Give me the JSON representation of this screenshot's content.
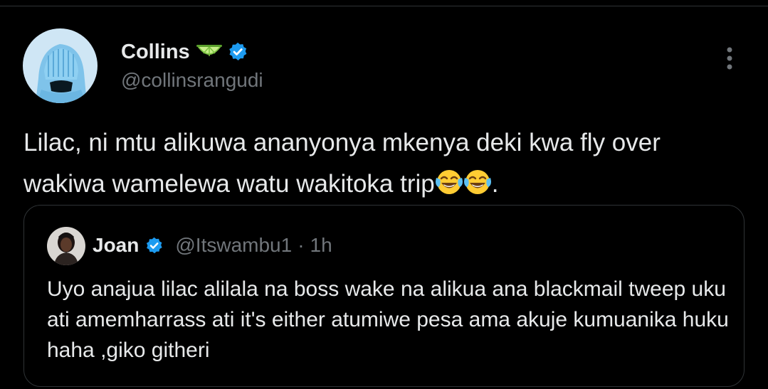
{
  "tweet": {
    "author": {
      "display_name": "Collins",
      "handle": "@collinsrangudi",
      "badge_emoji": "lime-icon",
      "verified": true
    },
    "text": "Lilac, ni mtu alikuwa ananyonya mkenya deki kwa fly over wakiwa wamelewa watu wakitoka trip",
    "text_end": ".",
    "emojis": [
      "face-with-tears-of-joy-icon",
      "face-with-tears-of-joy-icon"
    ]
  },
  "quoted_tweet": {
    "author": {
      "display_name": "Joan",
      "handle": "@Itswambu1",
      "verified": true
    },
    "separator": "·",
    "time": "1h",
    "text": "Uyo anajua lilac alilala na boss wake na alikua ana blackmail tweep uku ati amemharrass ati it's either atumiwe pesa ama akuje kumuanika huku haha ,giko githeri"
  },
  "colors": {
    "background": "#000000",
    "primary_text": "#e7e9ea",
    "secondary_text": "#71767b",
    "border": "#2f3336",
    "verified_blue": "#1d9bf0"
  }
}
